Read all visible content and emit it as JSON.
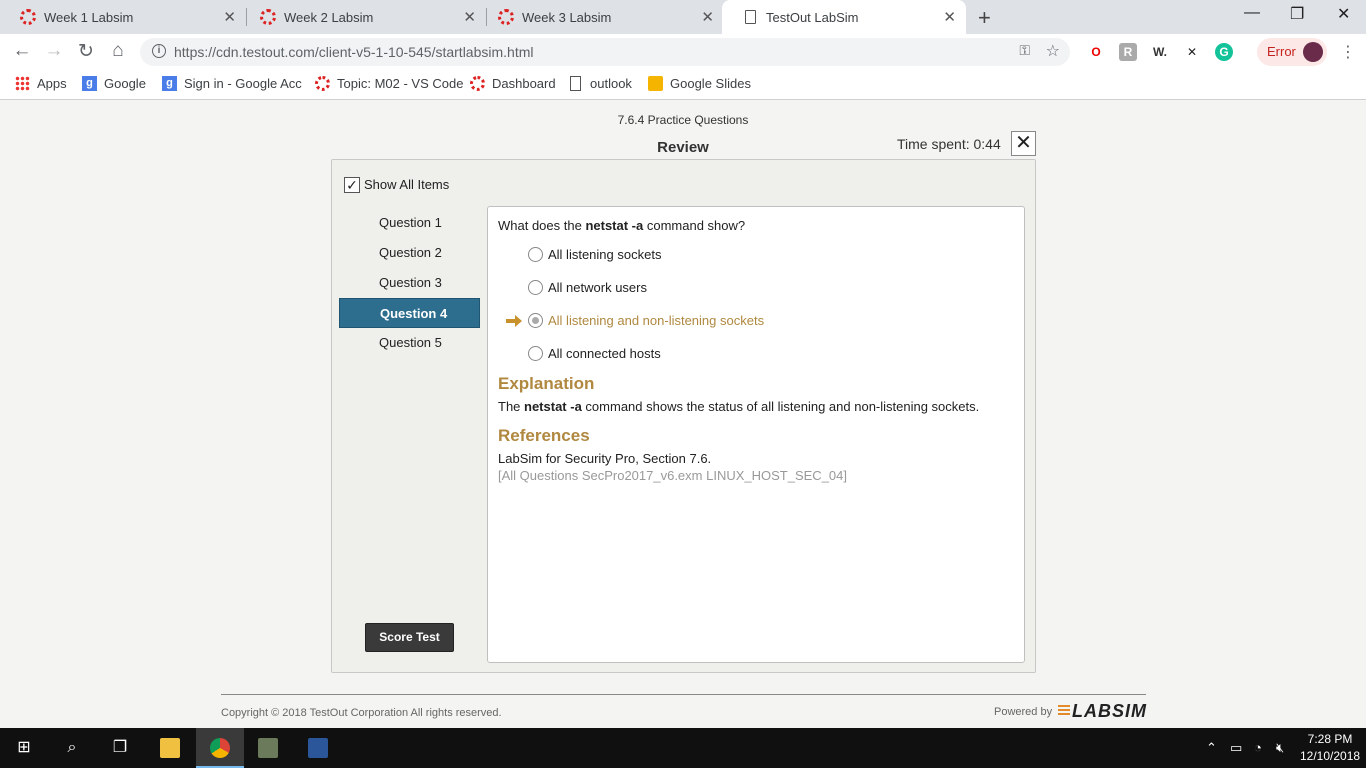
{
  "browser": {
    "tabs": [
      {
        "title": "Week 1 Labsim"
      },
      {
        "title": "Week 2 Labsim"
      },
      {
        "title": "Week 3 Labsim"
      },
      {
        "title": "TestOut LabSim"
      }
    ],
    "url": "https://cdn.testout.com/client-v5-1-10-545/startlabsim.html",
    "error_label": "Error",
    "bookmarks": [
      {
        "label": "Apps"
      },
      {
        "label": "Google"
      },
      {
        "label": "Sign in - Google Acc"
      },
      {
        "label": "Topic: M02 - VS Code"
      },
      {
        "label": "Dashboard"
      },
      {
        "label": "outlook"
      },
      {
        "label": "Google Slides"
      }
    ]
  },
  "exam": {
    "name": "7.6.4 Practice Questions",
    "mode_title": "Review",
    "time_spent": "Time spent: 0:44",
    "show_all_label": "Show All Items",
    "questions": [
      "Question 1",
      "Question 2",
      "Question 3",
      "Question 4",
      "Question 5"
    ],
    "active_question": "Question 4",
    "score_button": "Score Test"
  },
  "question": {
    "prefix": "What does the ",
    "command": "netstat -a",
    "suffix": " command show?",
    "answers": [
      "All listening sockets",
      "All network users",
      "All listening and non-listening sockets",
      "All connected hosts"
    ],
    "correct_index": 2,
    "explanation_heading": "Explanation",
    "explanation_prefix": "The ",
    "explanation_cmd": "netstat -a",
    "explanation_suffix": " command shows the status of all listening and non-listening sockets.",
    "references_heading": "References",
    "reference": "LabSim for Security Pro, Section 7.6.",
    "reference_source": "[All Questions SecPro2017_v6.exm LINUX_HOST_SEC_04]"
  },
  "footer": {
    "copyright": "Copyright © 2018  TestOut Corporation All rights reserved.",
    "powered_by": "Powered by",
    "logo_text": "LABSIM"
  },
  "taskbar": {
    "time": "7:28 PM",
    "date": "12/10/2018"
  },
  "colors": {
    "accent_blue": "#2d6e8e",
    "correct_gold": "#b08840"
  }
}
